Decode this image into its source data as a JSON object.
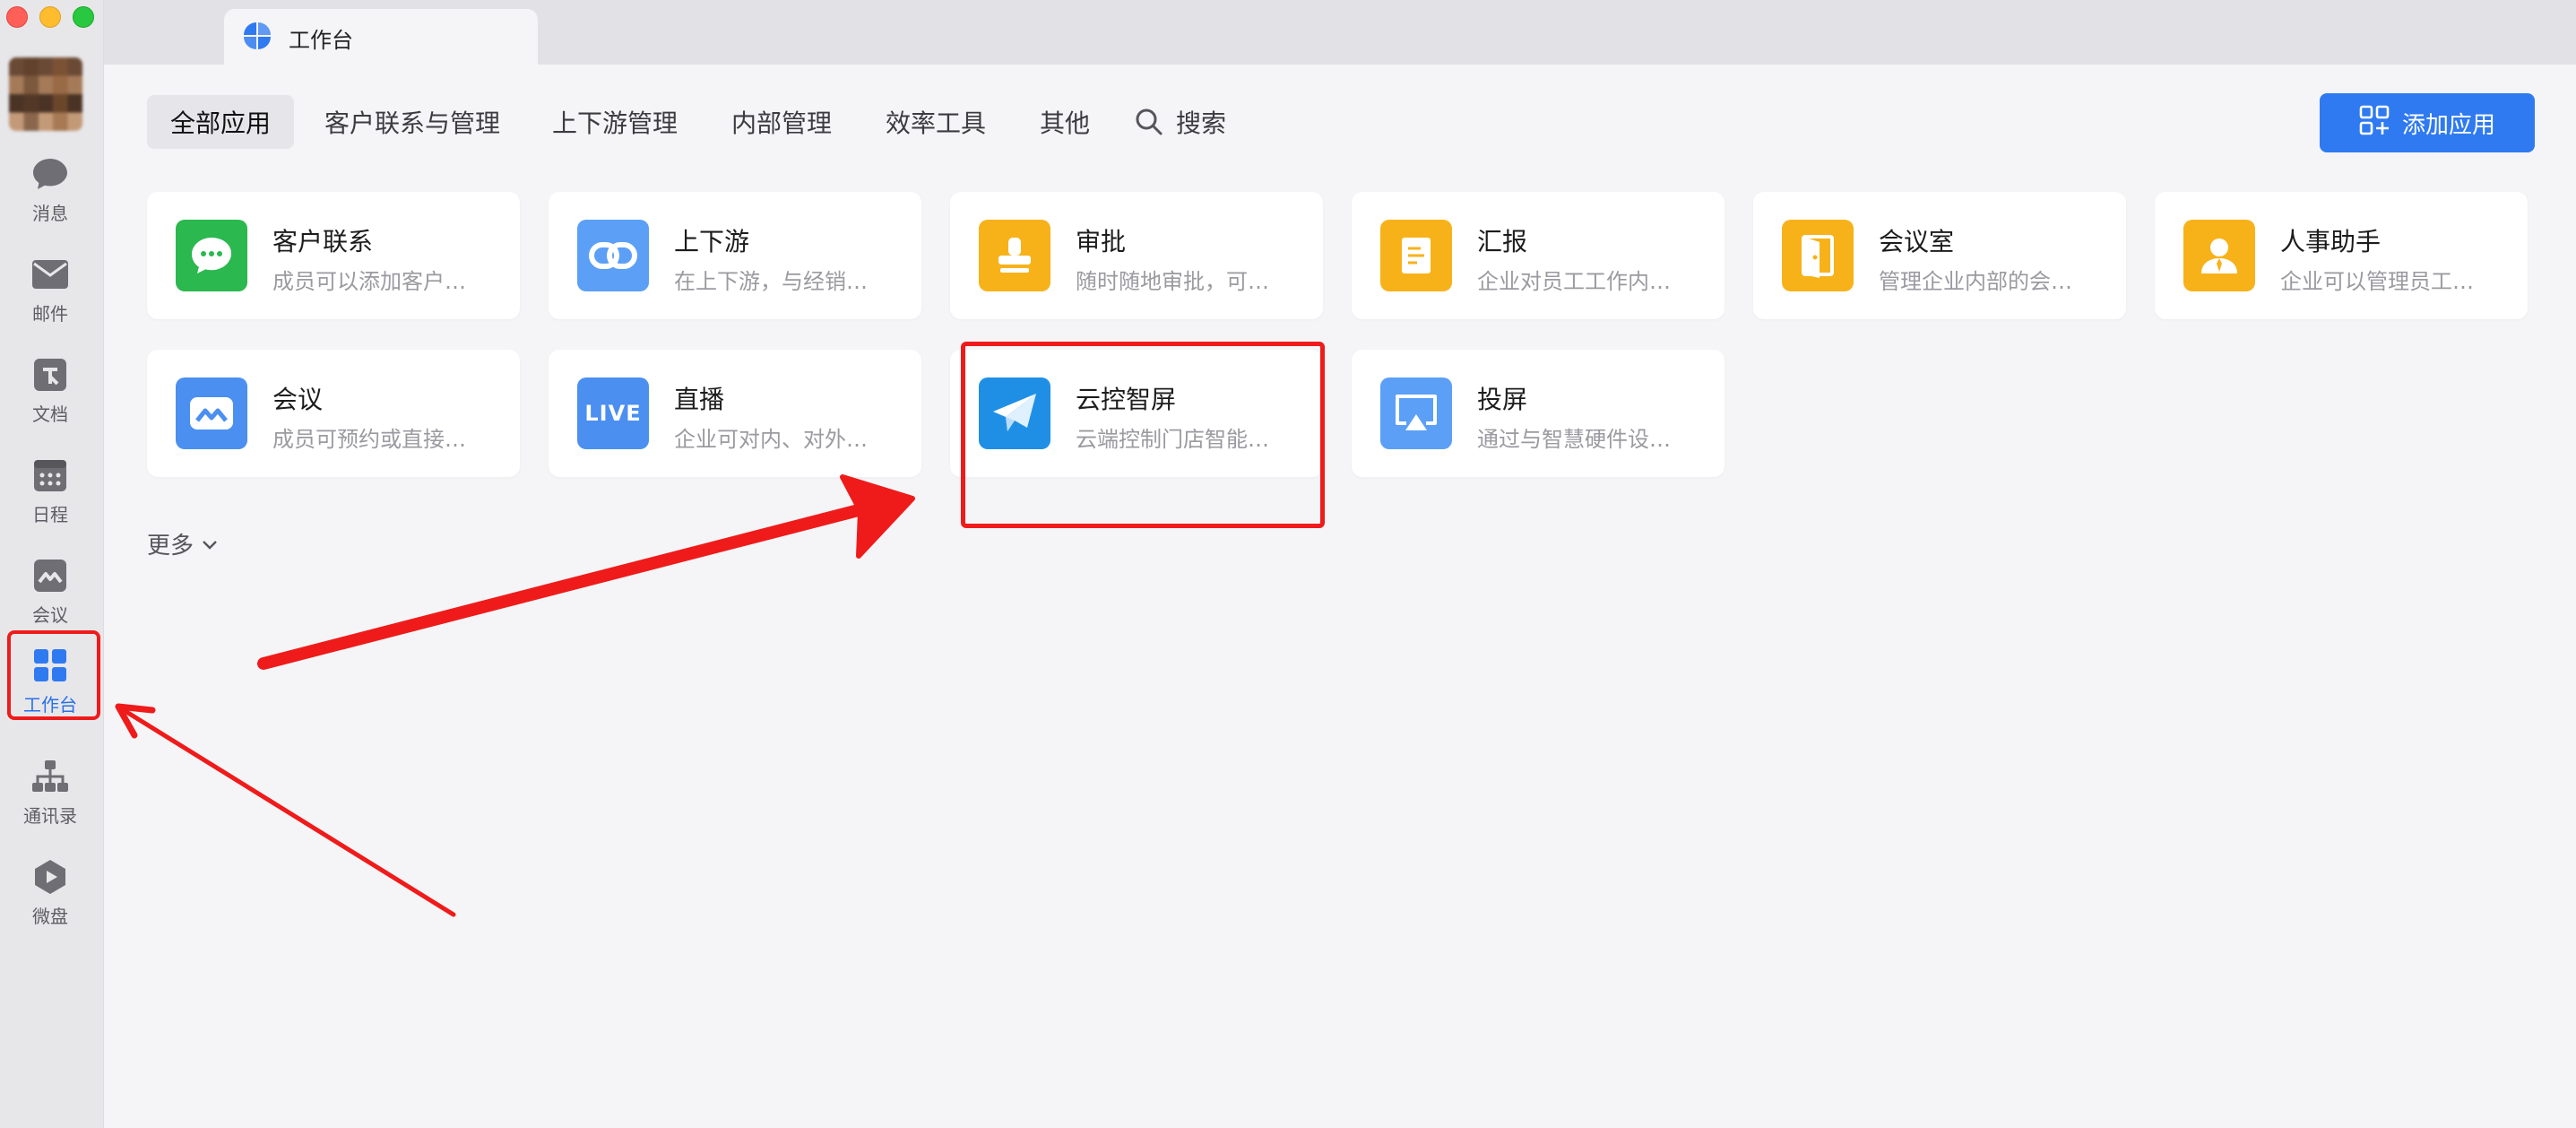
{
  "window": {
    "tab_title": "工作台"
  },
  "sidebar": {
    "items": [
      {
        "id": "messages",
        "label": "消息",
        "icon": "chat-bubble-icon"
      },
      {
        "id": "mail",
        "label": "邮件",
        "icon": "mail-icon"
      },
      {
        "id": "docs",
        "label": "文档",
        "icon": "document-icon"
      },
      {
        "id": "calendar",
        "label": "日程",
        "icon": "calendar-icon"
      },
      {
        "id": "meeting",
        "label": "会议",
        "icon": "meeting-icon"
      },
      {
        "id": "workbench",
        "label": "工作台",
        "icon": "grid-icon",
        "active": true
      },
      {
        "id": "contacts",
        "label": "通讯录",
        "icon": "org-chart-icon"
      },
      {
        "id": "drive",
        "label": "微盘",
        "icon": "drive-icon"
      }
    ]
  },
  "categories": [
    "全部应用",
    "客户联系与管理",
    "上下游管理",
    "内部管理",
    "效率工具",
    "其他"
  ],
  "search_label": "搜索",
  "add_button_label": "添加应用",
  "apps": [
    {
      "name": "客户联系",
      "desc": "成员可以添加客户…",
      "icon": "wechat-bubble-icon",
      "color": "#2bb84e"
    },
    {
      "name": "上下游",
      "desc": "在上下游，与经销…",
      "icon": "chain-link-icon",
      "color": "#5b9ff6"
    },
    {
      "name": "审批",
      "desc": "随时随地审批，可…",
      "icon": "stamp-icon",
      "color": "#f7b21a"
    },
    {
      "name": "汇报",
      "desc": "企业对员工工作内…",
      "icon": "report-icon",
      "color": "#f7b21a"
    },
    {
      "name": "会议室",
      "desc": "管理企业内部的会…",
      "icon": "door-icon",
      "color": "#f7b21a"
    },
    {
      "name": "人事助手",
      "desc": "企业可以管理员工…",
      "icon": "person-icon",
      "color": "#f7b21a"
    },
    {
      "name": "会议",
      "desc": "成员可预约或直接…",
      "icon": "meeting-logo-icon",
      "color": "#4b8ff0"
    },
    {
      "name": "直播",
      "desc": "企业可对内、对外…",
      "icon": "live-icon",
      "color": "#4b8ff0",
      "badge": "LIVE"
    },
    {
      "name": "云控智屏",
      "desc": "云端控制门店智能…",
      "icon": "paper-plane-icon",
      "color": "#1f8fe6"
    },
    {
      "name": "投屏",
      "desc": "通过与智慧硬件设…",
      "icon": "screen-cast-icon",
      "color": "#5b9ff6"
    }
  ],
  "more_label": "更多",
  "colors": {
    "accent": "#2f7af1",
    "annotation": "#ef1b1b"
  }
}
